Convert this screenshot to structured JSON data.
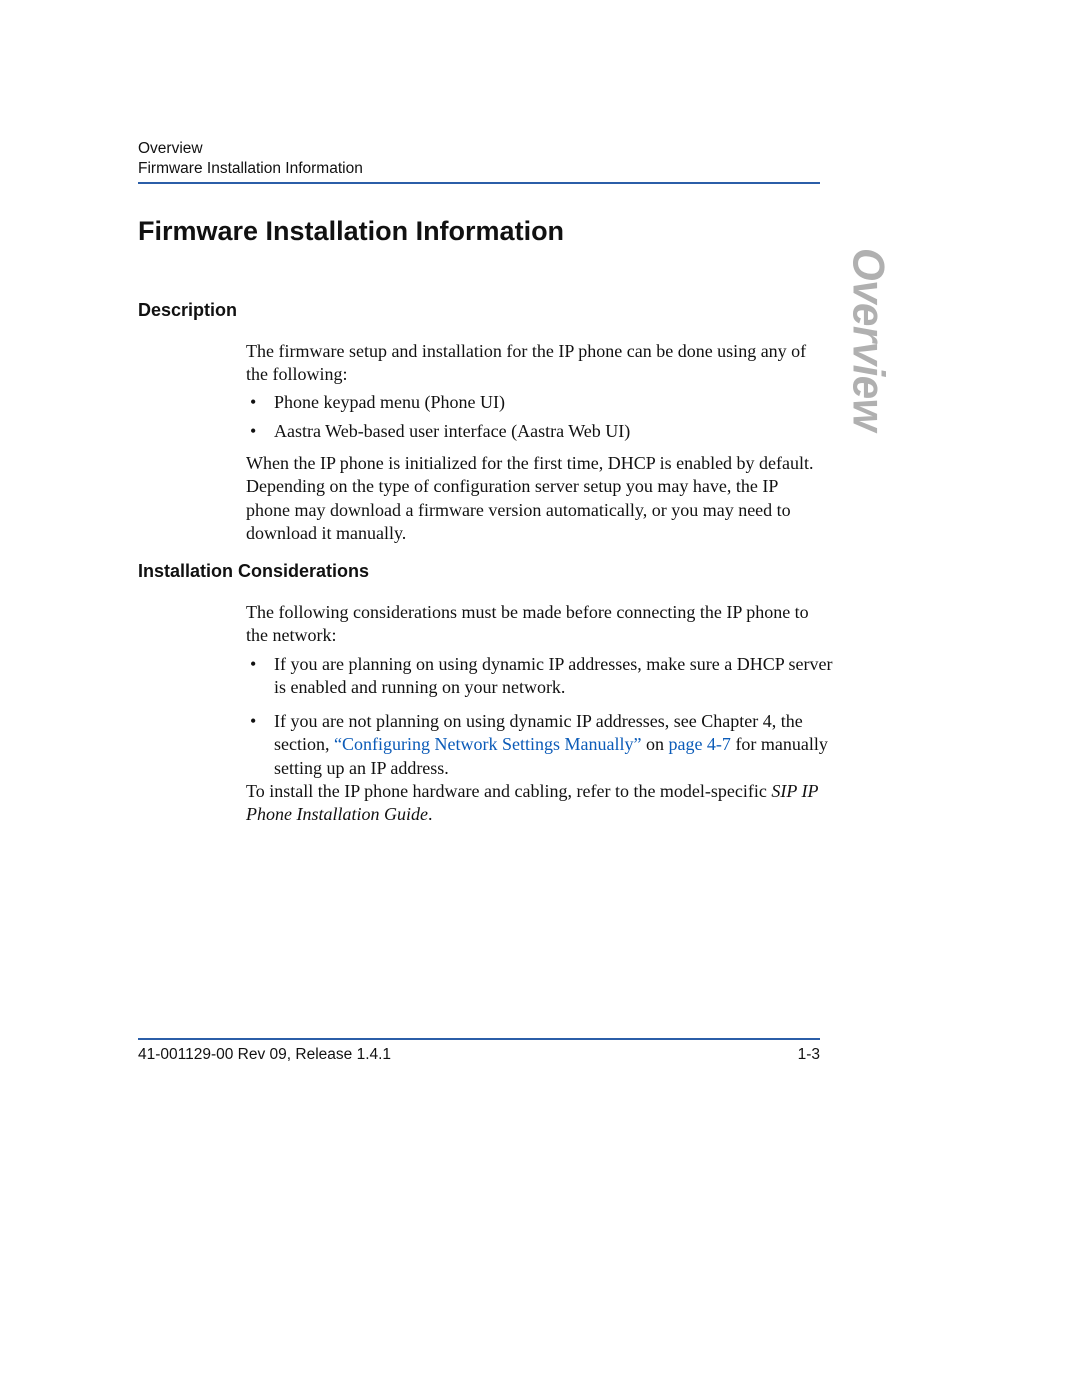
{
  "runhead": {
    "line1": "Overview",
    "line2": "Firmware Installation Information"
  },
  "sidetab": "Overview",
  "heading": "Firmware Installation Information",
  "sections": {
    "description": {
      "title": "Description",
      "intro": "The firmware setup and installation for the IP phone can be done using any of the following:",
      "bullets": [
        "Phone keypad menu (Phone UI)",
        "Aastra Web-based user interface (Aastra Web UI)"
      ],
      "after": "When the IP phone is initialized for the first time, DHCP is enabled by default. Depending on the type of configuration server setup you may have, the IP phone may download a firmware version automatically, or you may need to download it manually."
    },
    "considerations": {
      "title": "Installation Considerations",
      "intro": "The following considerations must be made before connecting the IP phone to the network:",
      "bullets": [
        {
          "text": "If you are planning on using dynamic IP addresses, make sure a DHCP server is enabled and running on your network."
        },
        {
          "pre": "If you are not planning on using dynamic IP addresses, see Chapter 4, the section, ",
          "link1": "“Configuring Network Settings Manually”",
          "mid": " on ",
          "link2": "page 4-7",
          "post": " for manually setting up an IP address."
        }
      ],
      "closing_pre": "To install the IP phone hardware and cabling, refer to the model-specific ",
      "closing_guide": "SIP IP Phone Installation Guide",
      "closing_post": "."
    }
  },
  "footer": {
    "left": "41-001129-00 Rev 09, Release 1.4.1",
    "right": "1-3"
  }
}
